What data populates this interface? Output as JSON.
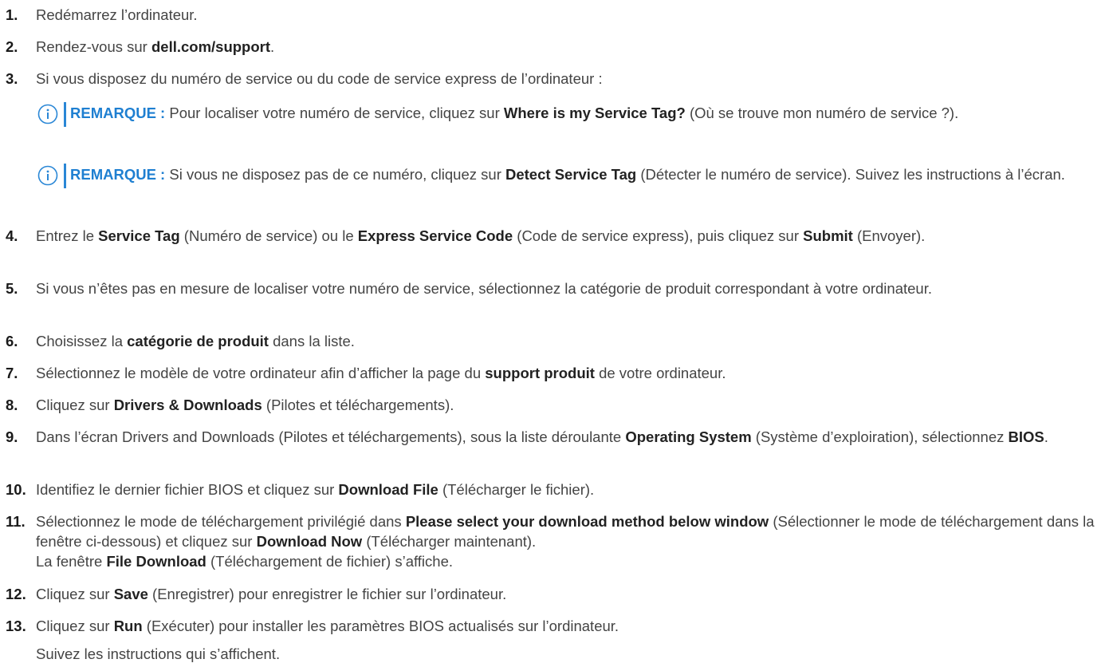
{
  "steps": [
    {
      "n": "1.",
      "parts": [
        {
          "t": "Redémarrez l’ordinateur."
        }
      ]
    },
    {
      "n": "2.",
      "parts": [
        {
          "t": "Rendez-vous sur "
        },
        {
          "t": "dell.com/support",
          "b": true
        },
        {
          "t": "."
        }
      ]
    },
    {
      "n": "3.",
      "parts": [
        {
          "t": "Si vous disposez du numéro de service ou du code de service express de l’ordinateur :"
        }
      ]
    },
    {
      "n": "4.",
      "parts": [
        {
          "t": "Entrez le "
        },
        {
          "t": "Service Tag",
          "b": true
        },
        {
          "t": " (Numéro de service) ou le "
        },
        {
          "t": "Express Service Code",
          "b": true
        },
        {
          "t": " (Code de service express), puis cliquez sur "
        },
        {
          "t": "Submit",
          "b": true
        },
        {
          "t": " (Envoyer)."
        }
      ]
    },
    {
      "n": "5.",
      "parts": [
        {
          "t": "Si vous n’êtes pas en mesure de localiser votre numéro de service, sélectionnez la catégorie de produit correspondant à votre ordinateur."
        }
      ]
    },
    {
      "n": "6.",
      "parts": [
        {
          "t": "Choisissez la "
        },
        {
          "t": "catégorie de produit",
          "b": true
        },
        {
          "t": " dans la liste."
        }
      ]
    },
    {
      "n": "7.",
      "parts": [
        {
          "t": "Sélectionnez le modèle de votre ordinateur afin d’afficher la page du "
        },
        {
          "t": "support produit",
          "b": true
        },
        {
          "t": " de votre ordinateur."
        }
      ]
    },
    {
      "n": "8.",
      "parts": [
        {
          "t": "Cliquez sur "
        },
        {
          "t": "Drivers & Downloads",
          "b": true
        },
        {
          "t": " (Pilotes et téléchargements)."
        }
      ]
    },
    {
      "n": "9.",
      "parts": [
        {
          "t": "Dans l’écran Drivers and Downloads (Pilotes et téléchargements), sous la liste déroulante "
        },
        {
          "t": "Operating System",
          "b": true
        },
        {
          "t": " (Système d’exploiration), sélectionnez "
        },
        {
          "t": "BIOS",
          "b": true
        },
        {
          "t": "."
        }
      ]
    },
    {
      "n": "10.",
      "parts": [
        {
          "t": "Identifiez le dernier fichier BIOS et cliquez sur "
        },
        {
          "t": "Download File",
          "b": true
        },
        {
          "t": " (Télécharger le fichier)."
        }
      ]
    },
    {
      "n": "11.",
      "parts": [
        {
          "t": "Sélectionnez le mode de téléchargement privilégié dans "
        },
        {
          "t": "Please select your download method below window",
          "b": true
        },
        {
          "t": " (Sélectionner le mode de téléchargement dans la fenêtre ci-dessous) et cliquez sur "
        },
        {
          "t": "Download Now",
          "b": true
        },
        {
          "t": " (Télécharger maintenant)."
        }
      ],
      "after": [
        {
          "t": "La fenêtre "
        },
        {
          "t": "File Download",
          "b": true
        },
        {
          "t": " (Téléchargement de fichier) s’affiche."
        }
      ]
    },
    {
      "n": "12.",
      "parts": [
        {
          "t": "Cliquez sur "
        },
        {
          "t": "Save",
          "b": true
        },
        {
          "t": " (Enregistrer) pour enregistrer le fichier sur l’ordinateur."
        }
      ]
    },
    {
      "n": "13.",
      "parts": [
        {
          "t": "Cliquez sur "
        },
        {
          "t": "Run",
          "b": true
        },
        {
          "t": " (Exécuter) pour installer les paramètres BIOS actualisés sur l’ordinateur."
        }
      ]
    }
  ],
  "notes": [
    {
      "label": "REMARQUE :",
      "parts": [
        {
          "t": " Pour localiser votre numéro de service, cliquez sur "
        },
        {
          "t": "Where is my Service Tag?",
          "b": true
        },
        {
          "t": " (Où se trouve mon numéro de service ?)."
        }
      ]
    },
    {
      "label": "REMARQUE :",
      "parts": [
        {
          "t": " Si vous ne disposez pas de ce numéro, cliquez sur "
        },
        {
          "t": "Detect Service Tag",
          "b": true
        },
        {
          "t": " (Détecter le numéro de service). Suivez les instructions à l’écran."
        }
      ]
    }
  ],
  "final_line": "Suivez les instructions qui s’affichent.",
  "colors": {
    "accent": "#2a87d6",
    "note_label": "#1e7fd1",
    "text": "#444444"
  },
  "icon": "info-circle-icon"
}
